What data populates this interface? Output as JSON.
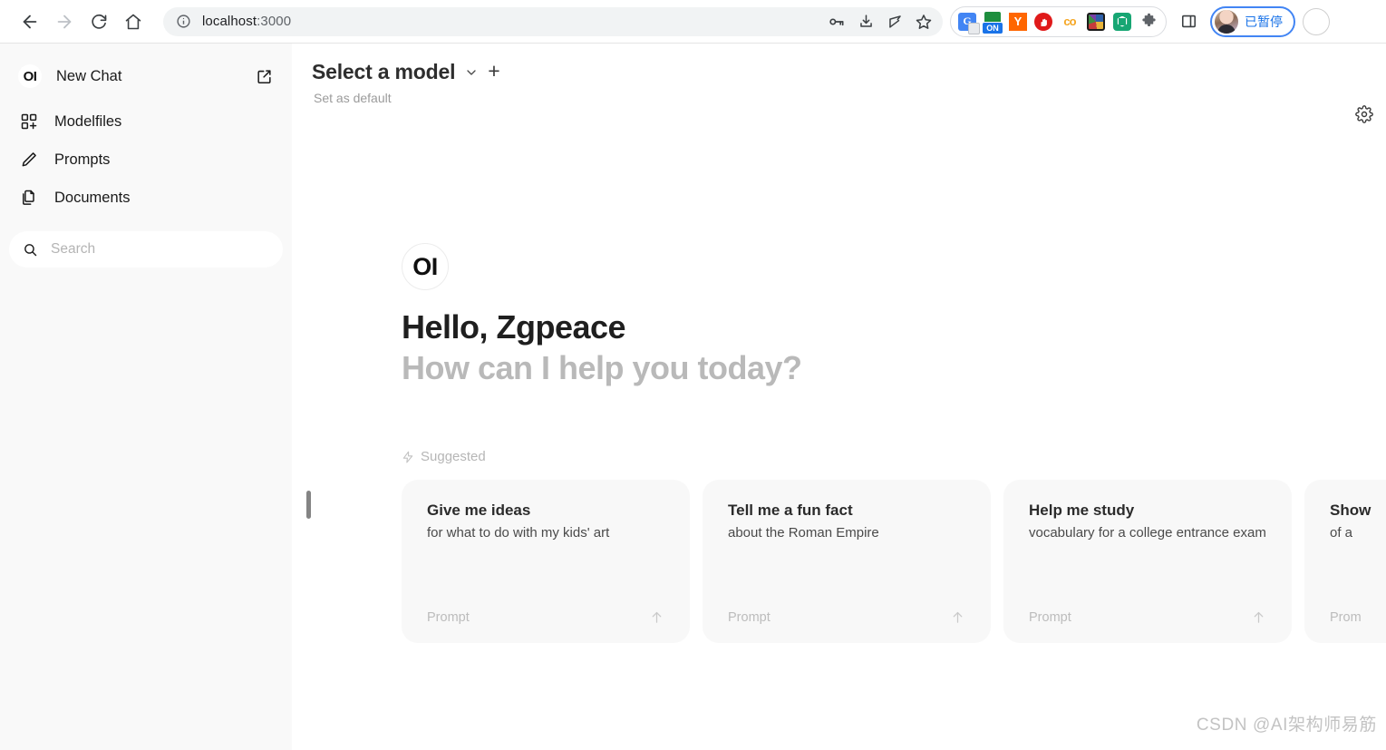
{
  "browser": {
    "back_tooltip": "Back",
    "forward_tooltip": "Forward",
    "reload_tooltip": "Reload",
    "home_tooltip": "Home",
    "url": "localhost",
    "url_port": ":3000",
    "omnibox_icons": [
      "info-icon",
      "password-key-icon",
      "download-icon",
      "share-icon",
      "bookmark-star-icon"
    ],
    "extensions": [
      {
        "name": "google-translate-icon",
        "label": "G"
      },
      {
        "name": "on-toggle-extension-icon",
        "label": "ON"
      },
      {
        "name": "yandex-extension-icon",
        "label": "Y"
      },
      {
        "name": "adblock-extension-icon",
        "label": ""
      },
      {
        "name": "co-extension-icon",
        "label": "co"
      },
      {
        "name": "pie-chart-extension-icon",
        "label": ""
      },
      {
        "name": "bitwarden-extension-icon",
        "label": ""
      },
      {
        "name": "puzzle-extensions-icon",
        "label": ""
      }
    ],
    "side_panel_icon": "side-panel-icon",
    "profile": {
      "status_label": "已暂停",
      "avatar_name": "user-avatar"
    }
  },
  "sidebar": {
    "new_chat": {
      "label": "New Chat",
      "logo": "OI",
      "edit_icon": "edit-square-icon"
    },
    "items": [
      {
        "label": "Modelfiles",
        "icon": "modelfiles-grid-icon"
      },
      {
        "label": "Prompts",
        "icon": "pencil-icon"
      },
      {
        "label": "Documents",
        "icon": "documents-copy-icon"
      }
    ],
    "search": {
      "placeholder": "Search",
      "value": "",
      "icon": "search-icon"
    }
  },
  "main": {
    "model_selector": {
      "label": "Select a model",
      "chevron_icon": "chevron-down-icon",
      "add_icon": "plus-icon",
      "set_default_label": "Set as default"
    },
    "settings_icon": "gear-icon",
    "greeting": {
      "logo": "OI",
      "line1": "Hello, Zgpeace",
      "line2": "How can I help you today?"
    },
    "suggested": {
      "label": "Suggested",
      "icon": "lightning-bolt-icon",
      "cards": [
        {
          "title": "Give me ideas",
          "subtitle": "for what to do with my kids' art",
          "footer_label": "Prompt",
          "arrow_icon": "arrow-up-icon"
        },
        {
          "title": "Tell me a fun fact",
          "subtitle": "about the Roman Empire",
          "footer_label": "Prompt",
          "arrow_icon": "arrow-up-icon"
        },
        {
          "title": "Help me study",
          "subtitle": "vocabulary for a college entrance exam",
          "footer_label": "Prompt",
          "arrow_icon": "arrow-up-icon"
        },
        {
          "title": "Show",
          "subtitle": "of a",
          "footer_label": "Prom",
          "arrow_icon": "arrow-up-icon"
        }
      ]
    },
    "watermark": "CSDN @AI架构师易筋"
  }
}
